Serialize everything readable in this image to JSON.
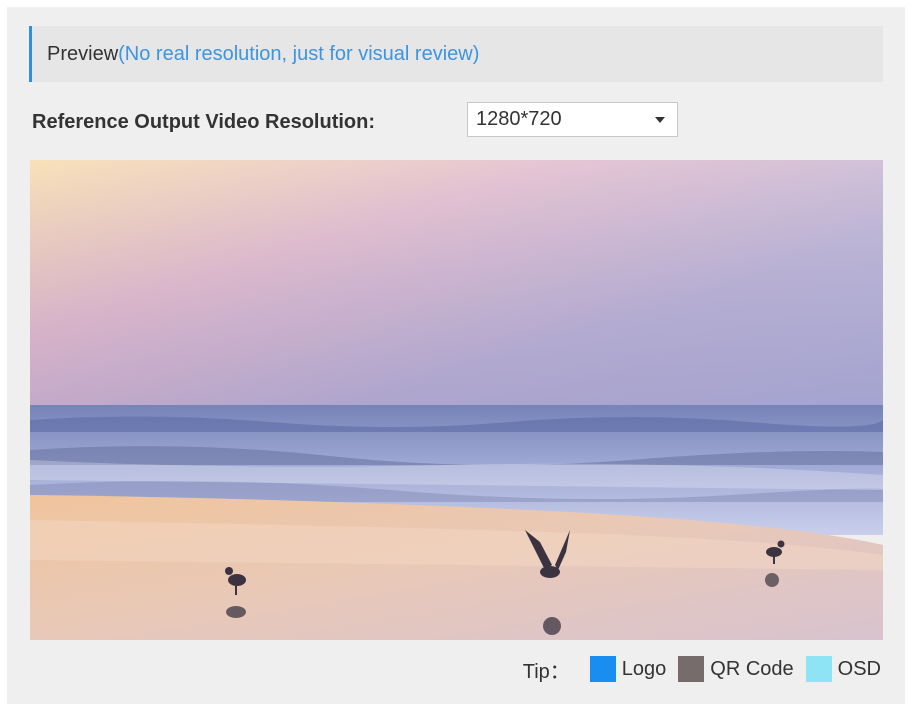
{
  "preview": {
    "title": "Preview",
    "note": "(No real resolution, just for visual review)"
  },
  "resolution": {
    "label": "Reference Output Video Resolution:",
    "selected": "1280*720"
  },
  "tip": {
    "label": "Tip：",
    "legend": [
      {
        "label": "Logo",
        "color": "#1a8ef0"
      },
      {
        "label": "QR Code",
        "color": "#766c6c"
      },
      {
        "label": "OSD",
        "color": "#8ee3f5"
      }
    ]
  },
  "colors": {
    "accent": "#2f8fdc",
    "note_text": "#3b95e0"
  }
}
